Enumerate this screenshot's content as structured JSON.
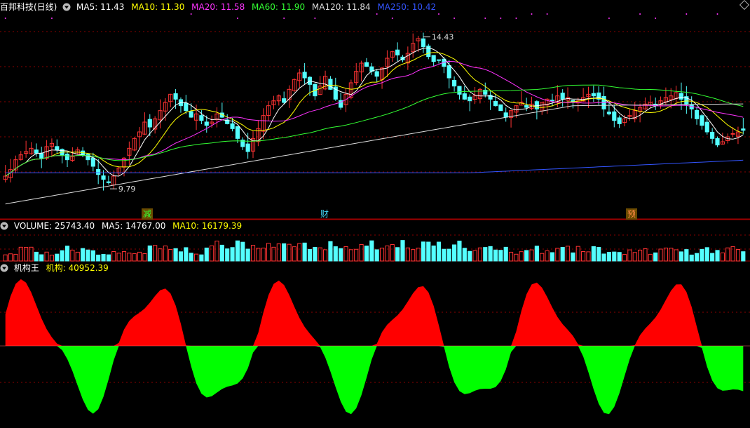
{
  "main": {
    "title": "百邦科技(日线)",
    "ma": [
      {
        "label": "MA5: 11.43",
        "color": "#ffffff"
      },
      {
        "label": "MA10: 11.30",
        "color": "#ffff00"
      },
      {
        "label": "MA20: 11.58",
        "color": "#ff33ff"
      },
      {
        "label": "MA60: 11.90",
        "color": "#33ff33"
      },
      {
        "label": "MA120: 11.84",
        "color": "#dddddd"
      },
      {
        "label": "MA250: 10.42",
        "color": "#3333ff"
      }
    ],
    "high_label": "14.43",
    "low_label": "9.79"
  },
  "events": [
    {
      "label": "减",
      "color": "#33ff33",
      "bg": "#6a4a00"
    },
    {
      "label": "财",
      "color": "#44ddff",
      "bg": "#000000"
    },
    {
      "label": "预",
      "color": "#ff8844",
      "bg": "#6a4a00"
    }
  ],
  "volume": {
    "label": "VOLUME: 25743.40",
    "ma5": "MA5: 14767.00",
    "ma10": "MA10: 16179.39"
  },
  "indicator": {
    "name": "机构王",
    "label": "机构: 40952.39"
  },
  "colors": {
    "up": "#ff3333",
    "down": "#54ffff",
    "pos": "#ff0000",
    "neg": "#00ff00",
    "grid": "#8b0000"
  },
  "chart_data": {
    "type": "candlestick",
    "price_range": [
      9.0,
      15.0
    ],
    "closes": [
      10.05,
      10.25,
      10.55,
      10.7,
      10.8,
      10.9,
      10.75,
      10.6,
      10.95,
      11.05,
      10.85,
      10.7,
      10.55,
      10.65,
      10.85,
      10.7,
      10.55,
      10.35,
      10.1,
      9.95,
      9.85,
      10.05,
      10.3,
      10.6,
      10.9,
      11.2,
      11.4,
      11.7,
      11.55,
      11.8,
      12.05,
      12.3,
      12.55,
      12.4,
      12.2,
      12.05,
      11.85,
      11.95,
      11.75,
      11.6,
      11.7,
      11.95,
      11.85,
      11.65,
      11.5,
      11.2,
      10.95,
      10.8,
      11.2,
      11.5,
      11.9,
      12.2,
      12.35,
      12.5,
      12.3,
      12.7,
      13.0,
      13.2,
      13.05,
      12.85,
      12.5,
      12.8,
      13.1,
      12.7,
      12.4,
      12.15,
      12.55,
      12.9,
      13.25,
      13.5,
      13.4,
      13.25,
      13.1,
      13.35,
      13.65,
      13.85,
      13.75,
      13.6,
      13.8,
      14.1,
      14.25,
      14.0,
      13.7,
      13.55,
      13.6,
      13.4,
      13.05,
      12.8,
      12.55,
      12.4,
      12.35,
      12.5,
      12.7,
      12.55,
      12.4,
      12.2,
      12.05,
      11.85,
      12.05,
      12.2,
      12.3,
      12.15,
      12.25,
      12.1,
      12.3,
      12.4,
      12.35,
      12.5,
      12.4,
      12.45,
      12.3,
      12.35,
      12.45,
      12.55,
      12.5,
      12.4,
      12.1,
      11.95,
      11.75,
      11.65,
      11.8,
      11.9,
      12.05,
      12.15,
      12.25,
      12.3,
      12.2,
      12.35,
      12.45,
      12.5,
      12.6,
      12.4,
      12.25,
      12.1,
      11.8,
      11.6,
      11.4,
      11.2,
      11.0,
      11.1,
      11.25,
      11.35,
      11.4,
      11.45
    ]
  }
}
